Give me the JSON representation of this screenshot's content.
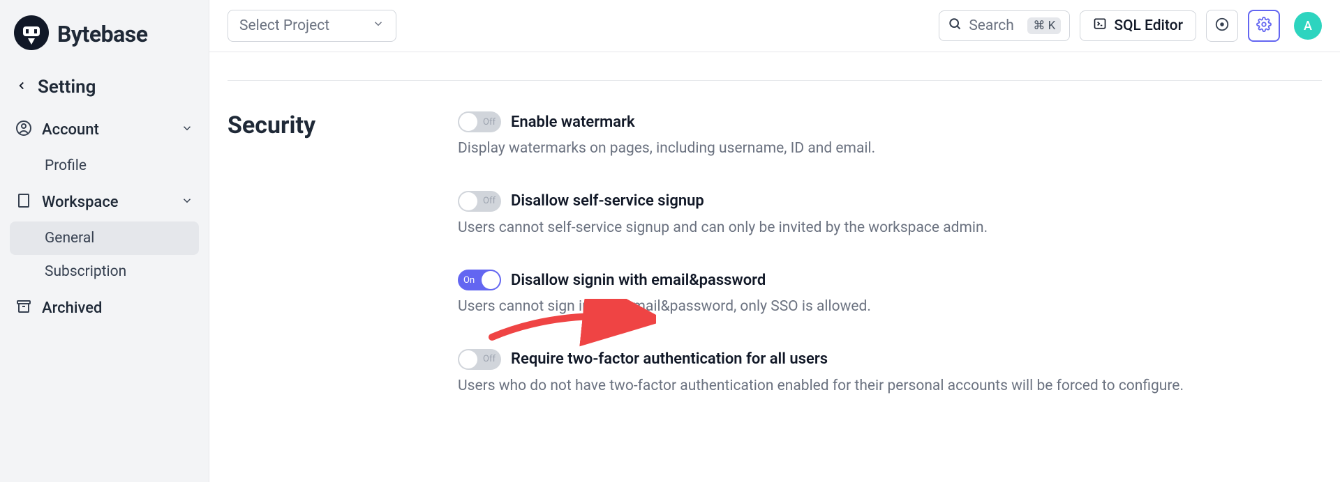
{
  "brand": {
    "name": "Bytebase"
  },
  "sidebar": {
    "back_title": "Setting",
    "sections": {
      "account": {
        "label": "Account",
        "items": [
          {
            "label": "Profile"
          }
        ]
      },
      "workspace": {
        "label": "Workspace",
        "items": [
          {
            "label": "General",
            "active": true
          },
          {
            "label": "Subscription"
          }
        ]
      },
      "archived": {
        "label": "Archived"
      }
    }
  },
  "topbar": {
    "select_project": "Select Project",
    "search_placeholder": "Search",
    "search_shortcut": "⌘ K",
    "sql_editor": "SQL Editor",
    "avatar_initial": "A"
  },
  "content": {
    "section_title": "Security",
    "options": [
      {
        "toggle": {
          "state": "off",
          "label": "Off"
        },
        "title": "Enable watermark",
        "desc": "Display watermarks on pages, including username, ID and email."
      },
      {
        "toggle": {
          "state": "off",
          "label": "Off"
        },
        "title": "Disallow self-service signup",
        "desc": "Users cannot self-service signup and can only be invited by the workspace admin."
      },
      {
        "toggle": {
          "state": "on",
          "label": "On"
        },
        "title": "Disallow signin with email&password",
        "desc": "Users cannot sign in with email&password, only SSO is allowed."
      },
      {
        "toggle": {
          "state": "off",
          "label": "Off"
        },
        "title": "Require two-factor authentication for all users",
        "desc": "Users who do not have two-factor authentication enabled for their personal accounts will be forced to configure."
      }
    ]
  }
}
